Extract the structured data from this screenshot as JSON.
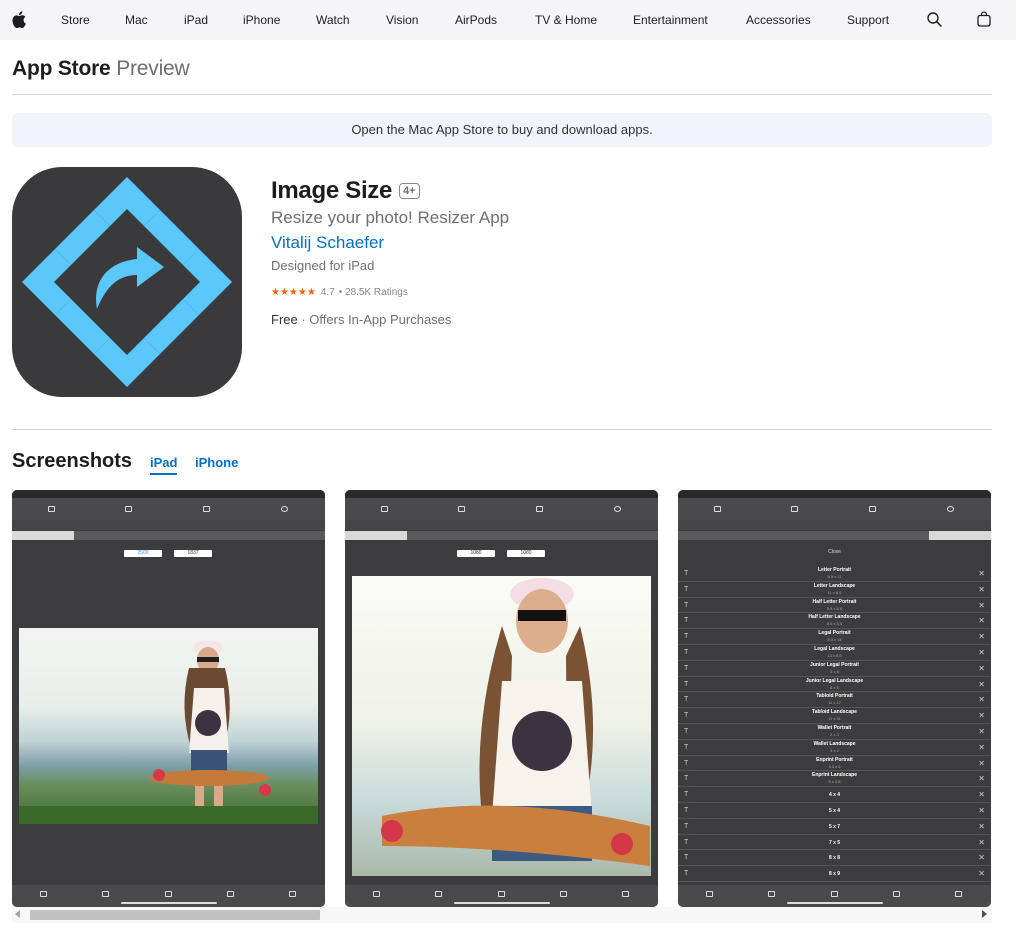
{
  "nav": {
    "items": [
      "Store",
      "Mac",
      "iPad",
      "iPhone",
      "Watch",
      "Vision",
      "AirPods",
      "TV & Home",
      "Entertainment",
      "Accessories",
      "Support"
    ]
  },
  "localnav": {
    "brand": "App Store",
    "brand_sub": "Preview"
  },
  "banner": {
    "text": "Open the Mac App Store to buy and download apps."
  },
  "app": {
    "title": "Image Size",
    "age_rating": "4+",
    "subtitle": "Resize your photo! Resizer App",
    "developer": "Vitalij Schaefer",
    "designed_for": "Designed for iPad",
    "stars": "★★★★★",
    "rating_value": "4.7",
    "rating_count": "• 28.5K Ratings",
    "price": "Free",
    "iap": "· Offers In-App Purchases"
  },
  "screenshots": {
    "title": "Screenshots",
    "tabs": [
      "iPad",
      "iPhone"
    ],
    "presets": [
      {
        "name": "Letter Portrait",
        "dim": "8.5 x 11"
      },
      {
        "name": "Letter Landscape",
        "dim": "11 x 8.5"
      },
      {
        "name": "Half Letter Portrait",
        "dim": "5.5 x 8.5"
      },
      {
        "name": "Half Letter Landscape",
        "dim": "8.5 x 5.5"
      },
      {
        "name": "Legal Portrait",
        "dim": "8.5 x 14"
      },
      {
        "name": "Legal Landscape",
        "dim": "14 x 8.5"
      },
      {
        "name": "Junior Legal Portrait",
        "dim": "5 x 8"
      },
      {
        "name": "Junior Legal Landscape",
        "dim": "8 x 5"
      },
      {
        "name": "Tabloid Portrait",
        "dim": "11 x 17"
      },
      {
        "name": "Tabloid Landscape",
        "dim": "17 x 11"
      },
      {
        "name": "Wallet Portrait",
        "dim": "2 x 3"
      },
      {
        "name": "Wallet Landscape",
        "dim": "3 x 2"
      },
      {
        "name": "Enprint Portrait",
        "dim": "3.5 x 5"
      },
      {
        "name": "Enprint Landscape",
        "dim": "5 x 3.5"
      },
      {
        "name": "4 x 4",
        "dim": ""
      },
      {
        "name": "5 x 4",
        "dim": ""
      },
      {
        "name": "5 x 7",
        "dim": ""
      },
      {
        "name": "7 x 5",
        "dim": ""
      },
      {
        "name": "8 x 8",
        "dim": ""
      },
      {
        "name": "8 x 9",
        "dim": ""
      }
    ],
    "close_label": "Close",
    "shot1_w": "2500",
    "shot1_h": "1837",
    "shot2_w": "1080",
    "shot2_h": "1080"
  },
  "colors": {
    "icon_bg": "#3a3a3c",
    "icon_accent": "#5ac8fa",
    "link": "#0070c9",
    "star": "#f56300"
  }
}
